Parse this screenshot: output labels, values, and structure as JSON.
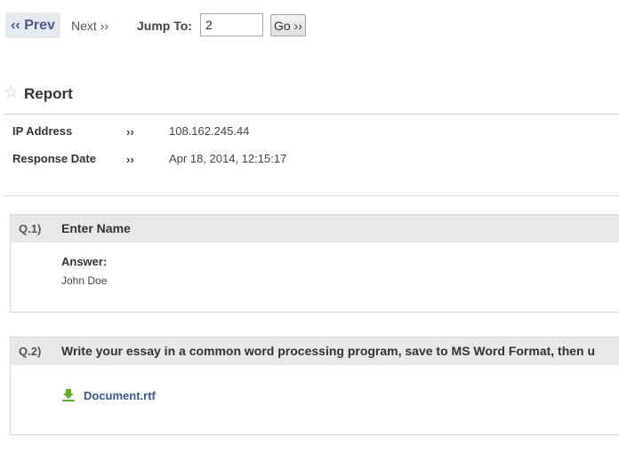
{
  "nav": {
    "prev_label": "‹‹ Prev",
    "next_label": "Next ››",
    "jump_label": "Jump To:",
    "jump_value": "2",
    "go_label": "Go ››"
  },
  "report": {
    "title": "Report",
    "fields": [
      {
        "label": "IP Address",
        "sep": "››",
        "value": "108.162.245.44"
      },
      {
        "label": "Response Date",
        "sep": "››",
        "value": "Apr 18, 2014, 12:15:17"
      }
    ]
  },
  "questions": [
    {
      "number": "Q.1)",
      "text": "Enter Name",
      "answer_label": "Answer:",
      "answer_value": "John Doe"
    },
    {
      "number": "Q.2)",
      "text": "Write your essay in a common word processing program, save to MS Word Format, then u",
      "file_name": "Document.rtf",
      "file_icon": "download-icon"
    }
  ],
  "colors": {
    "accent": "#3a5590",
    "header_bg": "#e8e8e8",
    "download_green": "#5fae2e"
  }
}
